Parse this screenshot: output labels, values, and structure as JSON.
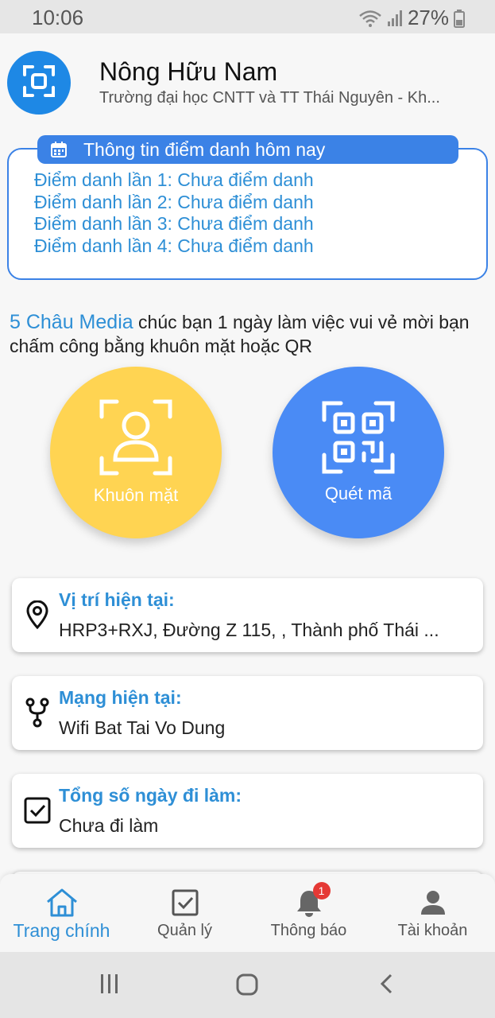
{
  "status_bar": {
    "time": "10:06",
    "battery": "27%"
  },
  "header": {
    "user_name": "Nông Hữu Nam",
    "organization": "Trường đại học CNTT và TT Thái Nguyên - Kh..."
  },
  "attendance": {
    "title": "Thông tin điểm danh hôm nay",
    "items": [
      "Điểm danh lần 1: Chưa điểm danh",
      "Điểm danh lần 2: Chưa điểm danh",
      "Điểm danh lần 3: Chưa điểm danh",
      "Điểm danh lần 4: Chưa điểm danh"
    ]
  },
  "greeting": {
    "brand": "5 Châu Media",
    "message": " chúc bạn 1 ngày làm việc vui vẻ mời bạn chấm công bằng khuôn mặt hoặc QR"
  },
  "actions": {
    "face_label": "Khuôn mặt",
    "qr_label": "Quét mã"
  },
  "info_cards": {
    "location": {
      "title": "Vị trí hiện tại:",
      "value": "HRP3+RXJ, Đường Z 115, , Thành phố Thái ..."
    },
    "network": {
      "title": "Mạng hiện tại:",
      "value": "Wifi Bat Tai Vo Dung"
    },
    "workdays": {
      "title": "Tổng số ngày đi làm:",
      "value": "Chưa đi làm"
    }
  },
  "bottom_nav": {
    "home": "Trang chính",
    "manage": "Quản lý",
    "notifications": "Thông báo",
    "notifications_badge": "1",
    "account": "Tài khoản"
  },
  "colors": {
    "primary": "#3b82e6",
    "accent_text": "#2e8fd6",
    "face_button": "#ffd452",
    "qr_button": "#4a8bf5",
    "badge": "#e53935"
  }
}
